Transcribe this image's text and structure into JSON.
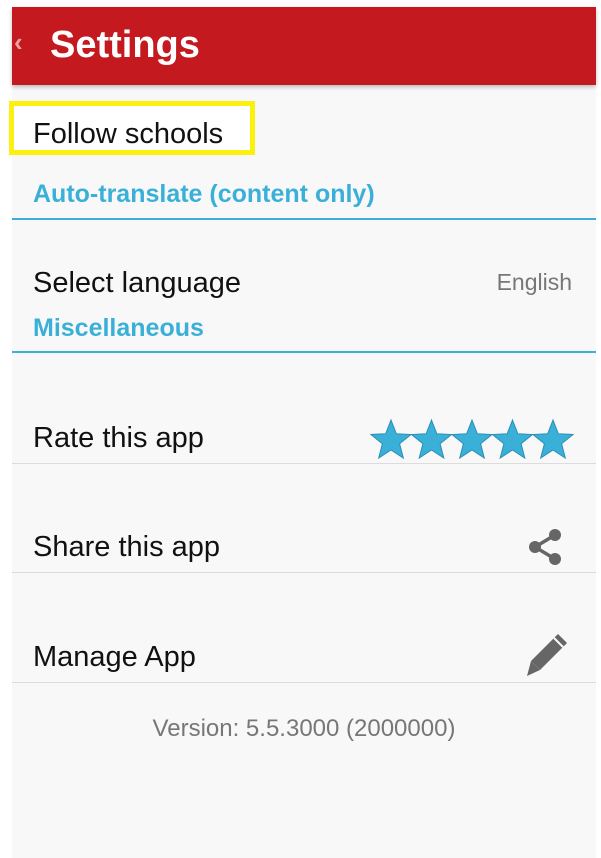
{
  "header": {
    "back_glyph": "‹",
    "title": "Settings"
  },
  "settings": {
    "follow_schools": "Follow schools",
    "auto_translate_section": "Auto-translate (content only)",
    "select_language_label": "Select language",
    "select_language_value": "English",
    "misc_section": "Miscellaneous",
    "rate_label": "Rate this app",
    "rate_stars": 5,
    "share_label": "Share this app",
    "manage_label": "Manage App",
    "version": "Version: 5.5.3000 (2000000)"
  },
  "colors": {
    "appbar": "#c3191f",
    "accent": "#3ab0d8",
    "highlight": "#fbf010",
    "star": "#3ab0d8"
  },
  "icons": {
    "back": "chevron-left-icon",
    "stars": "star-icon",
    "share": "share-icon",
    "manage": "pencil-icon"
  }
}
